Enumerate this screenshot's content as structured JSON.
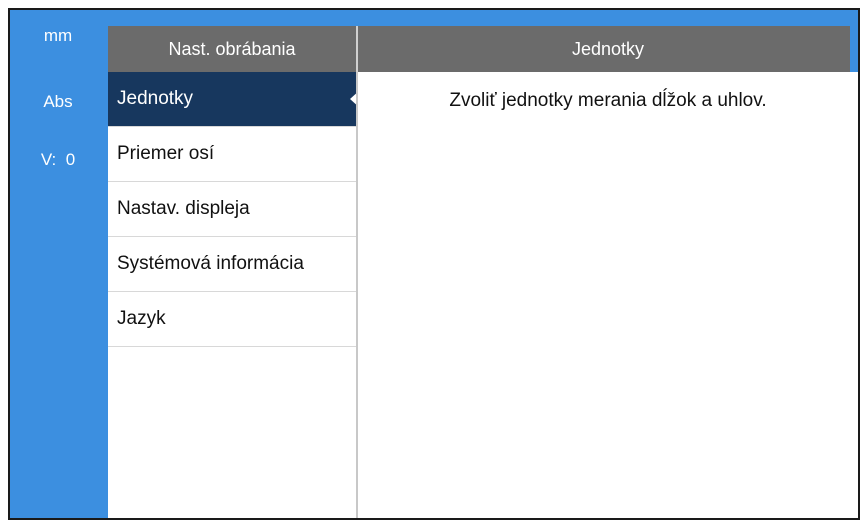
{
  "status_bar": {
    "units": "mm",
    "mode": "Abs",
    "v_label": "V:",
    "v_value": "0"
  },
  "menu": {
    "header": "Nast. obrábania",
    "items": [
      {
        "label": "Jednotky",
        "selected": true
      },
      {
        "label": "Priemer osí",
        "selected": false
      },
      {
        "label": "Nastav. displeja",
        "selected": false
      },
      {
        "label": "Systémová informácia",
        "selected": false
      },
      {
        "label": "Jazyk",
        "selected": false
      }
    ]
  },
  "content": {
    "header": "Jednotky",
    "description": "Zvoliť jednotky merania dĺžok a uhlov."
  },
  "colors": {
    "status_bar_bg": "#3c8fe0",
    "header_bg": "#6b6b6b",
    "selected_bg": "#17375e"
  }
}
